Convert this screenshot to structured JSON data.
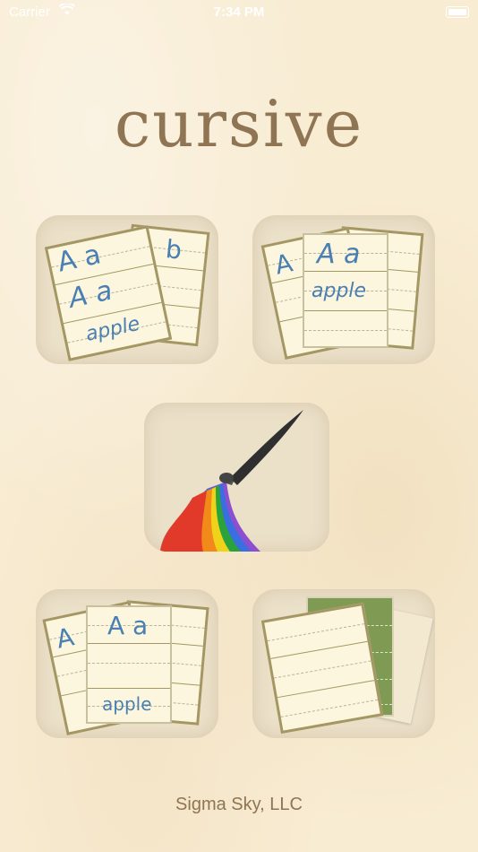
{
  "status_bar": {
    "carrier": "Carrier",
    "time": "7:34 PM"
  },
  "app": {
    "title": "cursive",
    "footer": "Sigma Sky, LLC"
  },
  "tiles": [
    {
      "icon": "flashcards-icon",
      "letters_a": "A a",
      "letters_b": "b",
      "word": "apple"
    },
    {
      "icon": "cursive-card-icon",
      "letters": "A a",
      "word": "apple",
      "edge": "A"
    },
    {
      "icon": "paint-brush-rainbow-icon"
    },
    {
      "icon": "tracing-card-icon",
      "letters": "A a",
      "word": "apple",
      "edge": "A"
    },
    {
      "icon": "blank-paper-icon"
    }
  ],
  "colors": {
    "background": "#f8ecd3",
    "title": "#8f7553",
    "tile": "#ebe0c8",
    "card_border": "#a49764",
    "ink": "#4a7fb3",
    "green_paper": "#7f9a52"
  }
}
